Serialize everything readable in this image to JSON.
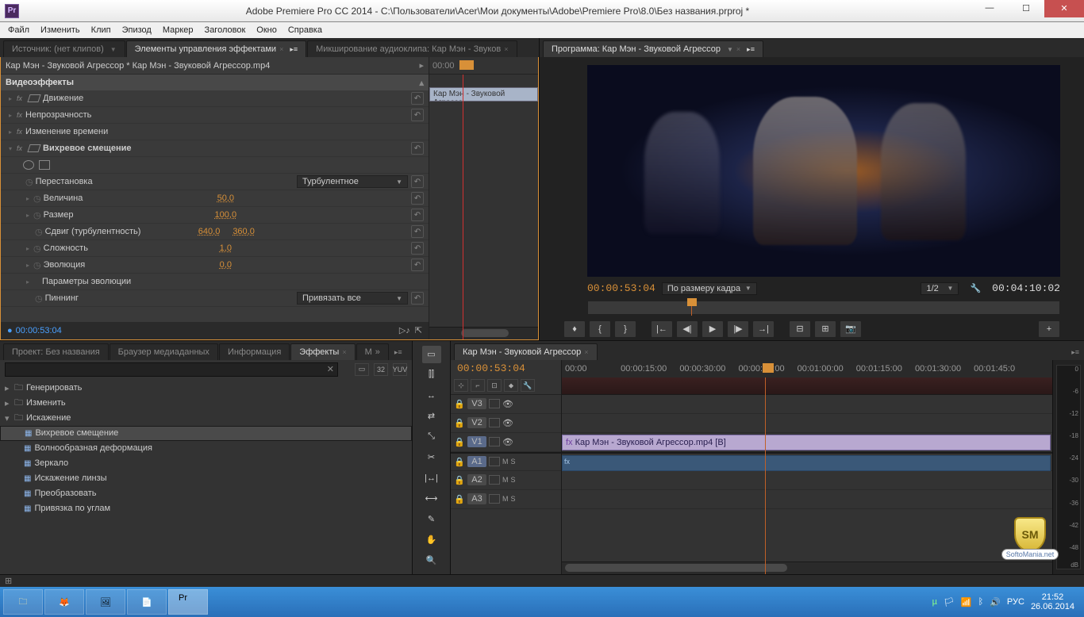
{
  "window": {
    "title": "Adobe Premiere Pro CC 2014 - C:\\Пользователи\\Acer\\Мои документы\\Adobe\\Premiere Pro\\8.0\\Без названия.prproj *",
    "app_badge": "Pr"
  },
  "menu": [
    "Файл",
    "Изменить",
    "Клип",
    "Эпизод",
    "Маркер",
    "Заголовок",
    "Окно",
    "Справка"
  ],
  "source_tabs": {
    "source": "Источник: (нет клипов)",
    "effect_controls": "Элементы управления эффектами",
    "audio_mixer": "Микширование аудиоклипа: Кар Мэн - Звуков"
  },
  "effect_controls": {
    "clip_path": "Кар Мэн - Звуковой Агрессор * Кар Мэн - Звуковой Агрессор.mp4",
    "section": "Видеоэффекты",
    "clip_label": "Кар Мэн - Звуковой Агрессо",
    "ruler_start": "00:00",
    "rows": {
      "motion": "Движение",
      "opacity": "Непрозрачность",
      "time_remap": "Изменение времени",
      "twirl": "Вихревое смещение",
      "swap": "Перестановка",
      "swap_val": "Турбулентное",
      "amount": "Величина",
      "amount_val": "50,0",
      "size": "Размер",
      "size_val": "100,0",
      "offset": "Сдвиг (турбулентность)",
      "offset_x": "640,0",
      "offset_y": "360,0",
      "complexity": "Сложность",
      "complexity_val": "1,0",
      "evolution": "Эволюция",
      "evolution_val": "0,0",
      "evo_options": "Параметры эволюции",
      "pinning": "Пиннинг",
      "pinning_val": "Привязать все"
    },
    "footer_tc": "00:00:53:04"
  },
  "program": {
    "tab": "Программа: Кар Мэн - Звуковой Агрессор",
    "current_tc": "00:00:53:04",
    "fit": "По размеру кадра",
    "res": "1/2",
    "duration_tc": "00:04:10:02"
  },
  "project_tabs": {
    "project": "Проект: Без названия",
    "media_browser": "Браузер медиаданных",
    "info": "Информация",
    "effects": "Эффекты",
    "markers_short": "М"
  },
  "effects_tree": {
    "generate": "Генерировать",
    "adjust": "Изменить",
    "distort": "Искажение",
    "items": {
      "twirl": "Вихревое смещение",
      "wave": "Волнообразная деформация",
      "mirror": "Зеркало",
      "lens": "Искажение линзы",
      "transform": "Преобразовать",
      "corner_pin": "Привязка по углам"
    }
  },
  "search_fields": {
    "icon_32": "32",
    "icon_yuv": "YUV"
  },
  "timeline": {
    "tab": "Кар Мэн - Звуковой Агрессор",
    "tc": "00:00:53:04",
    "ruler": [
      "00:00",
      "00:00:15:00",
      "00:00:30:00",
      "00:00:45:00",
      "00:01:00:00",
      "00:01:15:00",
      "00:01:30:00",
      "00:01:45:0"
    ],
    "tracks": {
      "v3": "V3",
      "v2": "V2",
      "v1": "V1",
      "a1": "A1",
      "a2": "A2",
      "a3": "A3"
    },
    "ms": {
      "m": "M",
      "s": "S"
    },
    "clip_label": "Кар Мэн - Звуковой Агрессор.mp4 [В]"
  },
  "meters": [
    "0",
    "-6",
    "-12",
    "-18",
    "-24",
    "-30",
    "-36",
    "-42",
    "-48",
    "dB"
  ],
  "taskbar": {
    "lang": "РУС",
    "time": "21:52",
    "date": "26.06.2014"
  },
  "watermark": {
    "initials": "SM",
    "text": "SoftoMania.net"
  }
}
